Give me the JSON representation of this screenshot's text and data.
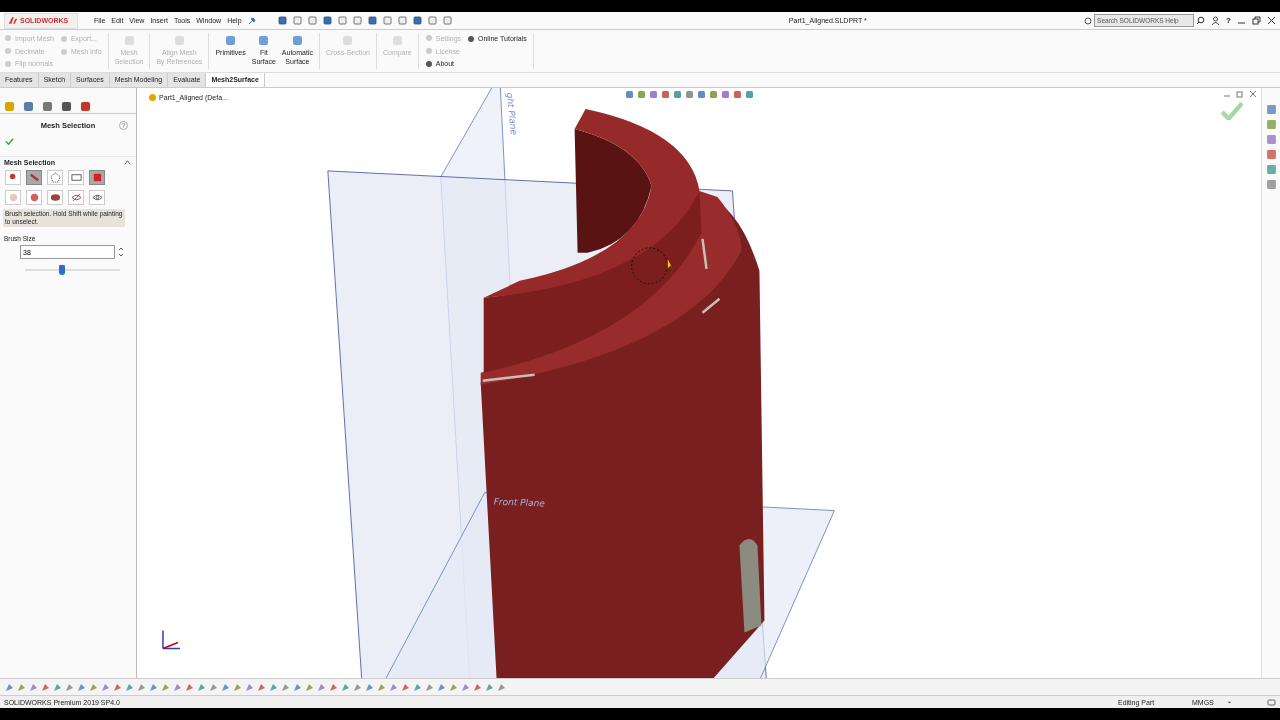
{
  "title_bar": {
    "logo": "SOLIDWORKS",
    "menu": [
      "File",
      "Edit",
      "View",
      "Insert",
      "Tools",
      "Window",
      "Help"
    ],
    "document_title": "Part1_Aligned.SLDPRT *",
    "search": {
      "placeholder": "Search SOLIDWORKS Help"
    },
    "help": "?"
  },
  "ribbon": {
    "groups": [
      {
        "columns": [
          {
            "kind": "small",
            "items": [
              {
                "label": "Import Mesh",
                "disabled": true
              },
              {
                "label": "Decimate",
                "disabled": true
              },
              {
                "label": "Flip normals",
                "disabled": true
              }
            ]
          },
          {
            "kind": "small",
            "items": [
              {
                "label": "Export...",
                "disabled": true
              },
              {
                "label": "Mesh Info",
                "disabled": true
              }
            ]
          }
        ]
      },
      {
        "columns": [
          {
            "kind": "large",
            "items": [
              {
                "label": "Mesh\nSelection",
                "disabled": true
              }
            ]
          }
        ]
      },
      {
        "columns": [
          {
            "kind": "large",
            "items": [
              {
                "label": "Align Mesh\nBy References",
                "disabled": true
              }
            ]
          }
        ]
      },
      {
        "columns": [
          {
            "kind": "large",
            "items": [
              {
                "label": "Primitives",
                "disabled": false
              }
            ]
          },
          {
            "kind": "large",
            "items": [
              {
                "label": "Fit\nSurface",
                "disabled": false
              }
            ]
          },
          {
            "kind": "large",
            "items": [
              {
                "label": "Automatic\nSurface",
                "disabled": false
              }
            ]
          }
        ]
      },
      {
        "columns": [
          {
            "kind": "large",
            "items": [
              {
                "label": "Cross-Section",
                "disabled": true
              }
            ]
          }
        ]
      },
      {
        "columns": [
          {
            "kind": "large",
            "items": [
              {
                "label": "Compare",
                "disabled": true
              }
            ]
          }
        ]
      },
      {
        "columns": [
          {
            "kind": "small",
            "items": [
              {
                "label": "Settings",
                "disabled": true
              },
              {
                "label": "License",
                "disabled": true
              },
              {
                "label": "About",
                "disabled": false
              }
            ]
          },
          {
            "kind": "small",
            "items": [
              {
                "label": "Online Tutorials",
                "disabled": false
              }
            ]
          }
        ]
      }
    ]
  },
  "tabs": [
    {
      "label": "Features",
      "selected": false
    },
    {
      "label": "Sketch",
      "selected": false
    },
    {
      "label": "Surfaces",
      "selected": false
    },
    {
      "label": "Mesh Modeling",
      "selected": false
    },
    {
      "label": "Evaluate",
      "selected": false
    },
    {
      "label": "Mesh2Surface",
      "selected": true
    }
  ],
  "panel": {
    "title": "Mesh Selection",
    "help": "?",
    "section": {
      "title": "Mesh Selection",
      "expanded": true
    },
    "tools": [
      {
        "selected": false
      },
      {
        "selected": true
      },
      {
        "selected": false
      },
      {
        "selected": false
      },
      {
        "selected": true
      },
      {
        "selected": false
      },
      {
        "selected": false
      },
      {
        "selected": false
      },
      {
        "selected": false
      },
      {
        "selected": false
      }
    ],
    "hint": "Brush selection. Hold Shift while painting to unselect.",
    "brush_size": {
      "label": "Brush Size",
      "value": "38",
      "level": 0.39
    }
  },
  "feature_tree": {
    "item": "Part1_Aligned  (Defa..."
  },
  "viewport": {
    "plane_labels": [
      "ght Plane",
      "Front Plane"
    ]
  },
  "status_bar": {
    "product": "SOLIDWORKS Premium 2019 SP4.0",
    "mode": "Editing Part",
    "units": "MMGS"
  }
}
